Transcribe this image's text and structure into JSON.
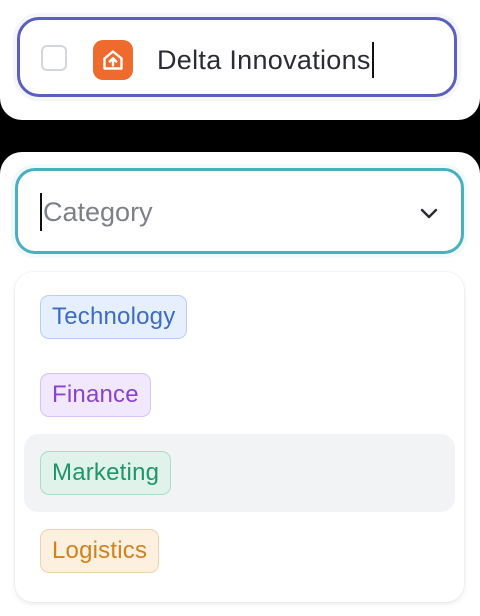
{
  "record": {
    "name_value": "Delta Innovations",
    "brand_color": "#ef6a2d",
    "icon": "house-upload-icon"
  },
  "category_select": {
    "placeholder": "Category",
    "chevron_icon": "chevron-down-icon",
    "options": [
      {
        "label": "Technology",
        "text_color": "#3d6bc8",
        "bg": "#e6effd",
        "border": "#b7cdf3"
      },
      {
        "label": "Finance",
        "text_color": "#8a44cc",
        "bg": "#f1e8fd",
        "border": "#d8c2f3"
      },
      {
        "label": "Marketing",
        "text_color": "#21946a",
        "bg": "#dff3ea",
        "border": "#acdcc7",
        "hovered": true
      },
      {
        "label": "Logistics",
        "text_color": "#d1821e",
        "bg": "#fdf0df",
        "border": "#f2d3a8"
      }
    ]
  },
  "colors": {
    "name_border": "#5a5fc0",
    "select_border": "#4ab0c1",
    "hover_bg": "#f2f3f5"
  }
}
